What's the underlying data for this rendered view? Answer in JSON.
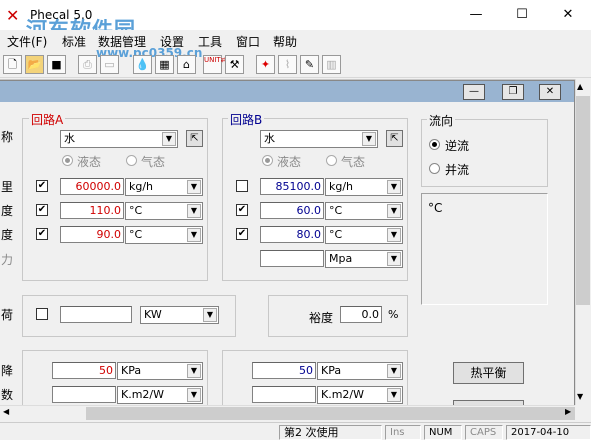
{
  "window": {
    "title": "Phecal 5.0",
    "minimize": "—",
    "maximize": "☐",
    "close": "✕"
  },
  "watermark": {
    "text": "河东软件园",
    "url": "www.pc0359.cn"
  },
  "menu": [
    "文件(F)",
    "标准",
    "数据管理",
    "设置",
    "工具",
    "窗口",
    "帮助"
  ],
  "child_controls": {
    "min": "—",
    "restore": "❐",
    "close": "✕"
  },
  "left_labels": [
    "称",
    "里",
    "度",
    "度",
    "力",
    "荷",
    "降",
    "数"
  ],
  "circuitA": {
    "title": "回路A",
    "fluid": "水",
    "phase_liquid": "液态",
    "phase_gas": "气态",
    "flow_value": "60000.0",
    "flow_unit": "kg/h",
    "temp_in": "110.0",
    "temp_in_unit": "°C",
    "temp_out": "90.0",
    "temp_out_unit": "°C",
    "pd_value": "50",
    "pd_unit": "KPa",
    "foul_unit": "K.m2/W"
  },
  "circuitB": {
    "title": "回路B",
    "fluid": "水",
    "phase_liquid": "液态",
    "phase_gas": "气态",
    "flow_value": "85100.0",
    "flow_unit": "kg/h",
    "temp_in": "60.0",
    "temp_in_unit": "°C",
    "temp_out": "80.0",
    "temp_out_unit": "°C",
    "pressure_unit": "Mpa",
    "pd_value": "50",
    "pd_unit": "KPa",
    "foul_unit": "K.m2/W"
  },
  "flow_dir": {
    "title": "流向",
    "counter": "逆流",
    "parallel": "并流"
  },
  "info_text": "°C",
  "load": {
    "unit": "KW"
  },
  "margin": {
    "label": "裕度",
    "value": "0.0",
    "unit": "%"
  },
  "heat_balance_button": "热平衡",
  "status": {
    "uses": "第2 次使用",
    "ins": "Ins",
    "num": "NUM",
    "caps": "CAPS",
    "date": "2017-04-10"
  },
  "colors": {
    "circuitA": "#d00000",
    "circuitB": "#000090",
    "child_caption": "#99b4d1"
  }
}
